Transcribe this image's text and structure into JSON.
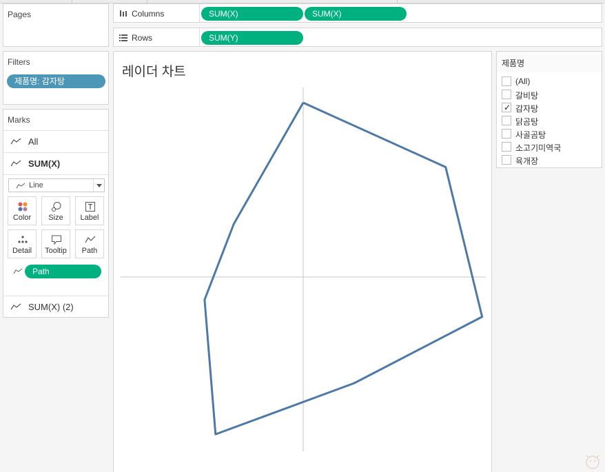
{
  "panels": {
    "pages": "Pages",
    "filters": "Filters",
    "marks": "Marks"
  },
  "filter_pill": "제품명: 감자탕",
  "marks": {
    "all_label": "All",
    "sumx_label": "SUM(X)",
    "mark_type": "Line",
    "buttons": {
      "color": "Color",
      "size": "Size",
      "label": "Label",
      "detail": "Detail",
      "tooltip": "Tooltip",
      "path": "Path"
    },
    "path_pill": "Path",
    "sumx2_label": "SUM(X) (2)"
  },
  "shelves": {
    "columns_label": "Columns",
    "columns_pills": [
      "SUM(X)",
      "SUM(X)"
    ],
    "rows_label": "Rows",
    "rows_pills": [
      "SUM(Y)"
    ]
  },
  "viz": {
    "title": "레이더 차트"
  },
  "legend": {
    "title": "제품명",
    "items": [
      {
        "label": "(All)",
        "checked": false
      },
      {
        "label": "갈비탕",
        "checked": false
      },
      {
        "label": "감자탕",
        "checked": true
      },
      {
        "label": "닭곰탕",
        "checked": false
      },
      {
        "label": "사골곰탕",
        "checked": false
      },
      {
        "label": "소고기미역국",
        "checked": false
      },
      {
        "label": "육개장",
        "checked": false
      }
    ]
  },
  "chart_data": {
    "type": "line",
    "x": [
      0.0,
      0.39,
      0.49,
      0.14,
      -0.24,
      -0.27,
      -0.19,
      0.0
    ],
    "y": [
      0.92,
      0.58,
      -0.21,
      -0.56,
      -0.83,
      -0.12,
      0.28,
      0.92
    ],
    "xlim": [
      -0.5,
      0.5
    ],
    "ylim": [
      -0.92,
      1.0
    ],
    "color": "#4e79a7",
    "grid": false,
    "zero_lines": true
  },
  "colors": {
    "pill_green": "#00b180",
    "pill_teal": "#4c96b8",
    "line": "#4e79a7"
  }
}
